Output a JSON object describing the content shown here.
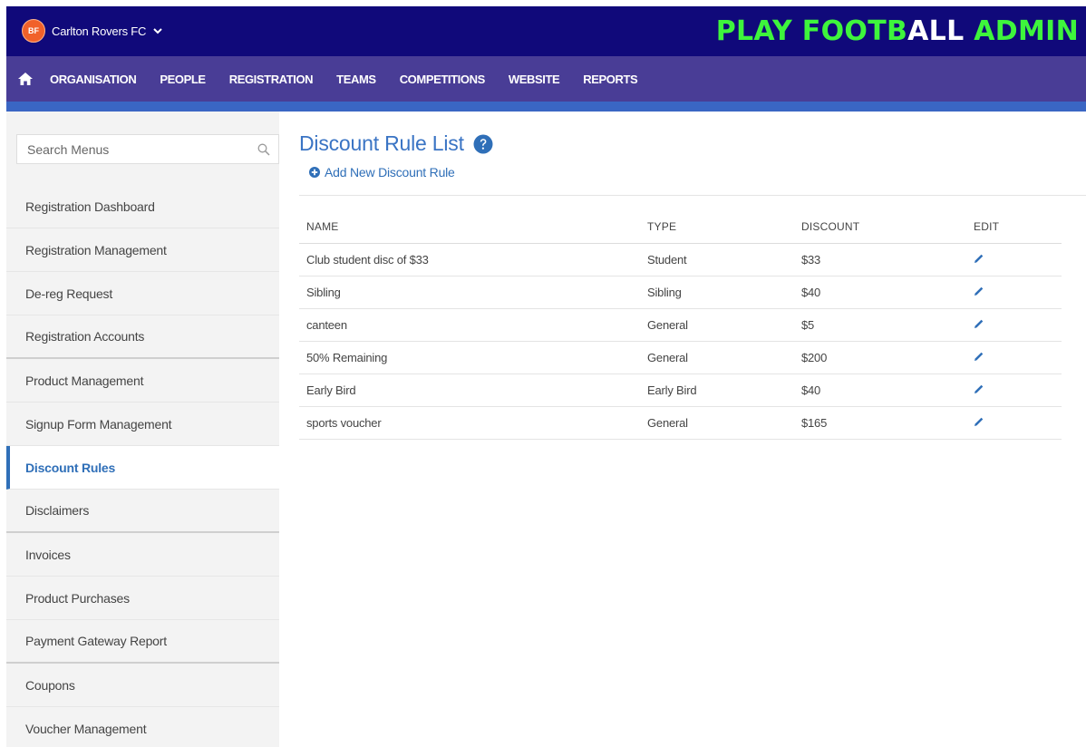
{
  "header": {
    "club_initials": "BF",
    "club_name": "Carlton Rovers FC",
    "brand_part1": "PLAY FOOTB",
    "brand_part2": "ALL",
    "brand_part3": " ADMIN",
    "brand_color": "#3ef53c",
    "bar_color": "#10097a"
  },
  "nav": {
    "home_icon": "home-icon",
    "items": [
      "ORGANISATION",
      "PEOPLE",
      "REGISTRATION",
      "TEAMS",
      "COMPETITIONS",
      "WEBSITE",
      "REPORTS"
    ],
    "bar_color": "#493d96",
    "accent_color": "#3a66c4"
  },
  "sidebar": {
    "search_placeholder": "Search Menus",
    "items": [
      "Registration Dashboard",
      "Registration Management",
      "De-reg Request",
      "Registration Accounts",
      "Product Management",
      "Signup Form Management",
      "Discount Rules",
      "Disclaimers",
      "Invoices",
      "Product Purchases",
      "Payment Gateway Report",
      "Coupons",
      "Voucher Management"
    ],
    "active_item": "Discount Rules"
  },
  "main": {
    "title": "Discount Rule List",
    "add_label": "Add New Discount Rule",
    "table": {
      "headers": [
        "NAME",
        "TYPE",
        "DISCOUNT",
        "EDIT"
      ],
      "rows": [
        {
          "name": "Club student disc of $33",
          "type": "Student",
          "discount": "$33"
        },
        {
          "name": "Sibling",
          "type": "Sibling",
          "discount": "$40"
        },
        {
          "name": "canteen",
          "type": "General",
          "discount": "$5"
        },
        {
          "name": "50% Remaining",
          "type": "General",
          "discount": "$200"
        },
        {
          "name": "Early Bird",
          "type": "Early Bird",
          "discount": "$40"
        },
        {
          "name": "sports voucher",
          "type": "General",
          "discount": "$165"
        }
      ]
    },
    "link_color": "#2f6fb8"
  }
}
